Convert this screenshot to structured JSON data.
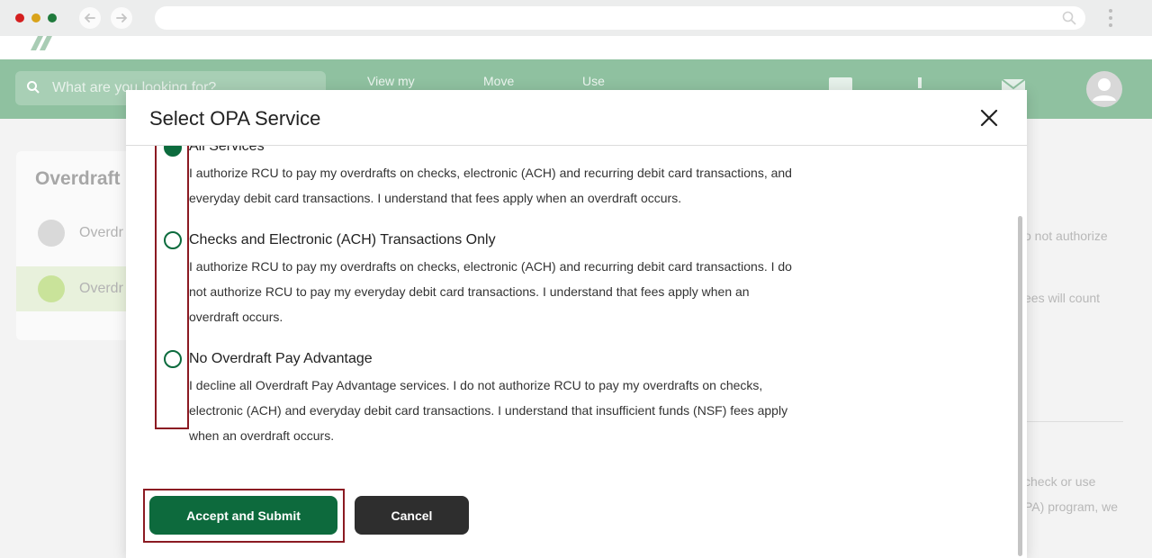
{
  "browser": {
    "url": ""
  },
  "site": {
    "search_placeholder": "What are you looking for?",
    "nav": [
      "View my",
      "Move",
      "Use"
    ],
    "sidebar": {
      "title": "Overdraft",
      "items": [
        "Overdr",
        "Overdr"
      ]
    },
    "right_fragments": [
      "o not authorize",
      "ees will count",
      "check or use",
      "PA) program, we"
    ]
  },
  "modal": {
    "title": "Select OPA Service",
    "options": [
      {
        "title": "All Services",
        "checked": true,
        "lines": [
          "I authorize RCU to pay my overdrafts on checks, electronic (ACH) and recurring debit card transactions, and",
          "everyday debit card transactions. I understand that fees apply when an overdraft occurs."
        ]
      },
      {
        "title": "Checks and Electronic (ACH) Transactions Only",
        "checked": false,
        "lines": [
          "I authorize RCU to pay my overdrafts on checks, electronic (ACH) and recurring debit card transactions. I do",
          "not authorize RCU to pay my everyday debit card transactions. I understand that fees apply when an",
          "overdraft occurs."
        ]
      },
      {
        "title": "No Overdraft Pay Advantage",
        "checked": false,
        "lines": [
          "I decline all Overdraft Pay Advantage services. I do not authorize RCU to pay my overdrafts on checks,",
          "electronic (ACH) and everyday debit card transactions. I understand that insufficient funds (NSF) fees apply",
          "when an overdraft occurs."
        ]
      }
    ],
    "submit_label": "Accept and Submit",
    "cancel_label": "Cancel"
  },
  "colors": {
    "brand_green": "#0d6a3d",
    "nav_green": "#8fc1a0",
    "highlight": "#8b1a22",
    "cancel_dark": "#2e2e2e"
  }
}
